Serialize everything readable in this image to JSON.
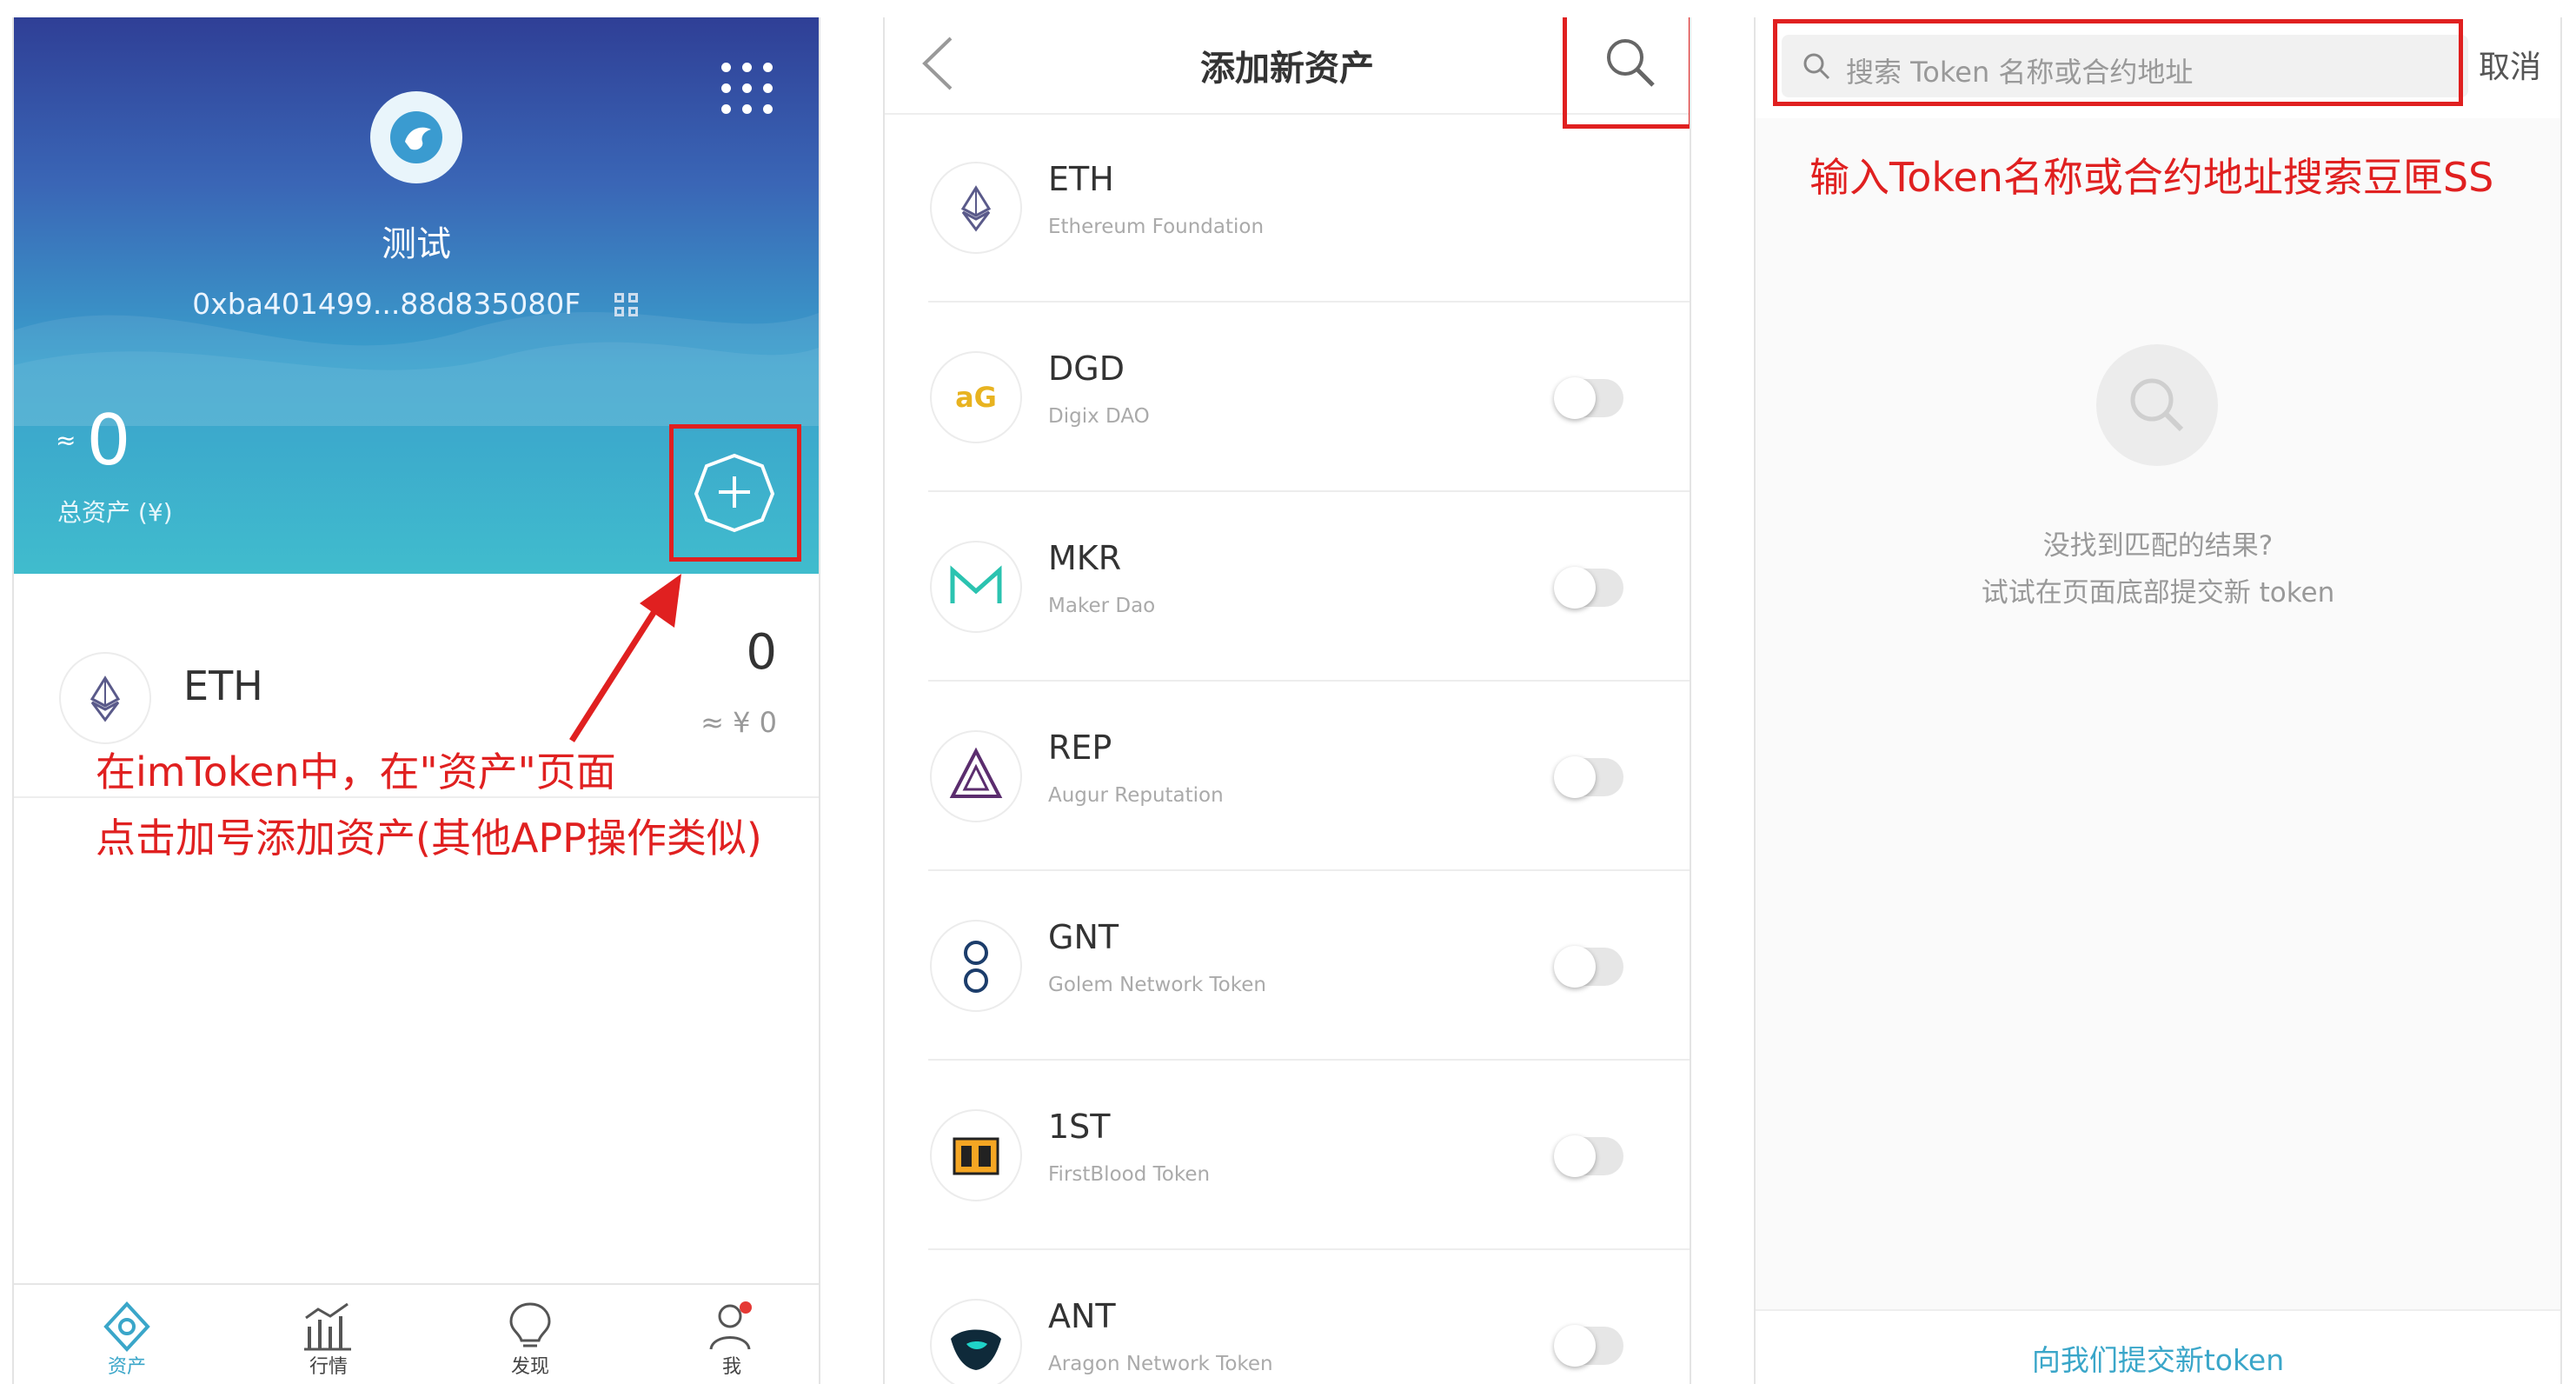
{
  "panel1": {
    "wallet_name": "测试",
    "wallet_address": "0xba401499...88d835080F",
    "total_approx": "≈",
    "total_value": "0",
    "total_label": "总资产 (¥)",
    "asset": {
      "name": "ETH",
      "amount": "0",
      "cny": "≈ ¥ 0"
    },
    "annotation_line1": "在imToken中，在\"资产\"页面",
    "annotation_line2": "点击加号添加资产(其他APP操作类似)",
    "tabs": [
      {
        "label": "资产",
        "icon": "assets-icon",
        "active": true
      },
      {
        "label": "行情",
        "icon": "market-chart-icon",
        "active": false
      },
      {
        "label": "发现",
        "icon": "lightbulb-icon",
        "active": false
      },
      {
        "label": "我",
        "icon": "profile-icon",
        "active": false
      }
    ],
    "colors": {
      "annotation": "#e02020",
      "active_tab": "#3aa6c9",
      "header_top": "#2f3f96",
      "header_bottom": "#40bccd"
    }
  },
  "panel2": {
    "title": "添加新资产",
    "tokens": [
      {
        "symbol": "ETH",
        "name": "Ethereum Foundation",
        "has_toggle": false,
        "enabled": false
      },
      {
        "symbol": "DGD",
        "name": "Digix DAO",
        "has_toggle": true,
        "enabled": false
      },
      {
        "symbol": "MKR",
        "name": "Maker Dao",
        "has_toggle": true,
        "enabled": false
      },
      {
        "symbol": "REP",
        "name": "Augur Reputation",
        "has_toggle": true,
        "enabled": false
      },
      {
        "symbol": "GNT",
        "name": "Golem Network Token",
        "has_toggle": true,
        "enabled": false
      },
      {
        "symbol": "1ST",
        "name": "FirstBlood Token",
        "has_toggle": true,
        "enabled": false
      },
      {
        "symbol": "ANT",
        "name": "Aragon Network Token",
        "has_toggle": true,
        "enabled": false
      }
    ]
  },
  "panel3": {
    "search_placeholder": "搜索 Token 名称或合约地址",
    "cancel_label": "取消",
    "annotation": "输入Token名称或合约地址搜索豆匣SS",
    "empty_line1": "没找到匹配的结果?",
    "empty_line2": "试试在页面底部提交新 token",
    "submit_link": "向我们提交新token"
  }
}
